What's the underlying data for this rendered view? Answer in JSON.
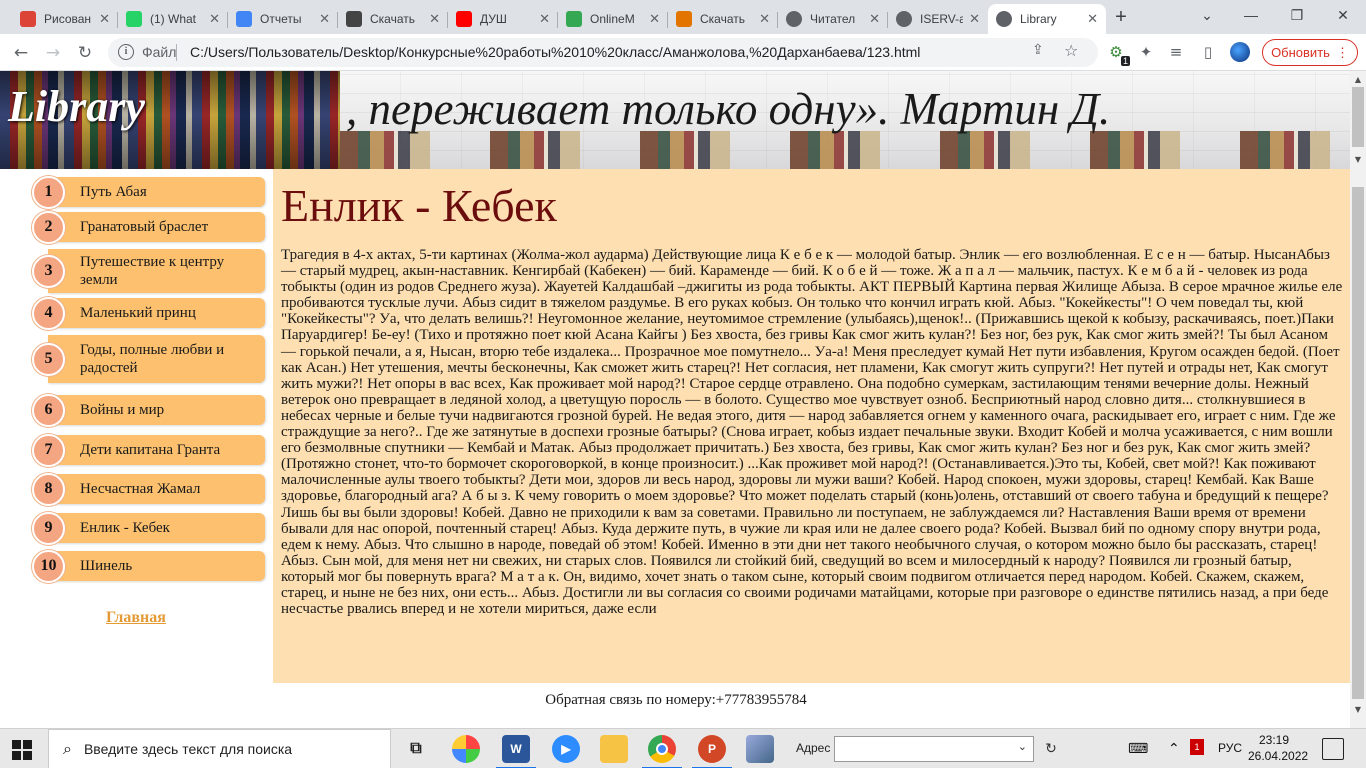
{
  "browser": {
    "tabs": [
      {
        "label": "Рисован",
        "icon_color": "#db4437",
        "icon": "drawing-icon"
      },
      {
        "label": "(1) What",
        "icon_color": "#25d366",
        "icon": "whatsapp-icon"
      },
      {
        "label": "Отчеты",
        "icon_color": "#4285f4",
        "icon": "report-icon"
      },
      {
        "label": "Скачать",
        "icon_color": "#444444",
        "icon": "download-s-icon"
      },
      {
        "label": "ДУШ",
        "icon_color": "#ff0000",
        "icon": "youtube-icon"
      },
      {
        "label": "OnlineM",
        "icon_color": "#34a853",
        "icon": "online-icon"
      },
      {
        "label": "Скачать",
        "icon_color": "#e37400",
        "icon": "download-globe-icon"
      },
      {
        "label": "Читател",
        "icon_color": "#5f6368",
        "icon": "globe-icon"
      },
      {
        "label": "ISERV-al",
        "icon_color": "#5f6368",
        "icon": "globe-icon"
      },
      {
        "label": "Library",
        "icon_color": "#5f6368",
        "icon": "globe-icon"
      }
    ],
    "file_label": "Файл",
    "url": "C:/Users/Пользователь/Desktop/Конкурсные%20работы%2010%20класс/Аманжолова,%20Дарханбаева/123.html",
    "update_label": "Обновить",
    "ext_badge": "1"
  },
  "page": {
    "logo": "Library",
    "quote": ", переживает только одну». Мартин Д.",
    "menu": [
      {
        "num": "1",
        "label": "Путь Абая"
      },
      {
        "num": "2",
        "label": "Гранатовый браслет"
      },
      {
        "num": "3",
        "label": "Путешествие к центру земли"
      },
      {
        "num": "4",
        "label": "Маленький принц"
      },
      {
        "num": "5",
        "label": "Годы, полные любви и радостей"
      },
      {
        "num": "6",
        "label": "Войны и мир"
      },
      {
        "num": "7",
        "label": "Дети капитана Гранта"
      },
      {
        "num": "8",
        "label": "Несчастная Жамал"
      },
      {
        "num": "9",
        "label": "Енлик - Кебек"
      },
      {
        "num": "10",
        "label": "Шинель"
      }
    ],
    "home_link": "Главная",
    "title": "Енлик - Кебек",
    "body": "Трагедия в 4-х актах, 5-ти картинах (Жолма-жол аударма) Действующие лица К е б е к — молодой батыр. Энлик — его возлюбленная. Е с е н — батыр. НысанАбыз — старый мудрец, акын-наставник. Кенгирбай (Кабекен) — бий. Караменде — бий. К о б е й — тоже. Ж а п а л — мальчик, пастух. К е м б а й - человек из рода тобыкты (один из родов Среднего жуза). Жауетей Калдашбай –джигиты из рода тобыкты. АКТ ПЕРВЫЙ Картина первая Жилище Абыза. В серое мрачное жилье еле пробиваются тусклые лучи. Абыз сидит в тяжелом раздумье. В его руках кобыз. Он только что кончил играть кюй. Абыз. \"Кокейкесты\"! О чем поведал ты, кюй \"Кокейкесты\"? Уа, что делать велишь?! Неугомонное желание, неутомимое стремление (улыбаясь),щенок!.. (Прижавшись щекой к кобызу, раскачиваясь, поет.)Паки Паруардигер! Бе-еу! (Тихо и протяжно поет кюй Асана Кайгы ) Без хвоста, без гривы Как смог жить кулан?! Без ног, без рук, Как смог жить змей?! Ты был Асаном — горькой печали, а я, Нысан, вторю тебе издалека... Прозрачное мое помутнело... Уа-а! Меня преследует кумай Нет пути избавления, Кругом осажден бедой. (Поет как Асан.) Нет утешения, мечты бесконечны, Как сможет жить старец?! Нет согласия, нет пламени, Как смогут жить супруги?! Нет путей и отрады нет, Как смогут жить мужи?! Нет опоры в вас всех, Как проживает мой народ?! Старое сердце отравлено. Она подобно сумеркам, застилающим тенями вечерние долы. Нежный ветерок оно превращает в ледяной холод, а цветущую поросль — в болото. Существо мое чувствует озноб. Бесприютный народ словно дитя... столкнувшиеся в небесах черные и белые тучи надвигаются грозной бурей. Не ведая этого, дитя — народ забавляется огнем у каменного очага, раскидывает его, играет с ним. Где же страждущие за него?.. Где же затянутые в доспехи грозные батыры? (Снова играет, кобыз издает печальные звуки. Входит Кобей и молча усаживается, с ним вошли его безмолвные спутники — Кембай и Матак. Абыз продолжает причитать.) Без хвоста, без гривы, Как смог жить кулан? Без ног и без рук, Как смог жить змей? (Протяжно стонет, что-то бормочет скороговоркой, в конце произносит.) ...Как проживет мой народ?! (Останавливается.)Это ты, Кобей, свет мой?! Как поживают малочисленные аулы твоего тобыкты? Дети мои, здоров ли весь народ, здоровы ли мужи ваши? Кобей. Народ спокоен, мужи здоровы, старец! Кембай. Как Ваше здоровье, благородный ага? А б ы з. К чему говорить о моем здоровье? Что может поделать старый (конь)олень, отставший от своего табуна и бредущий к пещере? Лишь бы вы были здоровы! Кобей. Давно не приходили к вам за советами. Правильно ли поступаем, не заблуждаемся ли? Наставления Ваши время от времени бывали для нас опорой, почтенный старец! Абыз. Куда держите путь, в чужие ли края или не далее своего рода? Кобей. Вызвал бий по одному спору внутри рода, едем к нему. Абыз. Что слышно в народе, поведай об этом! Кобей. Именно в эти дни нет такого необычного случая, о котором можно было бы рассказать, старец! Абыз. Сын мой, для меня нет ни свежих, ни старых слов. Появился ли стойкий бий, сведущий во всем и милосердный к народу? Появился ли грозный батыр, который мог бы повернуть врага? М а т а к. Он, видимо, хочет знать о таком сыне, который своим подвигом отличается перед народом. Кобей. Скажем, скажем, старец, и ныне не без них, они есть... Абыз. Достигли ли вы согласия со своими родичами матайцами, которые при разговоре о единстве пятились назад, а при беде несчастье рвались вперед и не хотели мириться, даже если",
    "footer": "Обратная связь по номеру:+77783955784"
  },
  "taskbar": {
    "search_placeholder": "Введите здесь текст для поиска",
    "address_label": "Адрес",
    "language": "РУС",
    "time": "23:19",
    "date": "26.04.2022",
    "badge": "1"
  }
}
